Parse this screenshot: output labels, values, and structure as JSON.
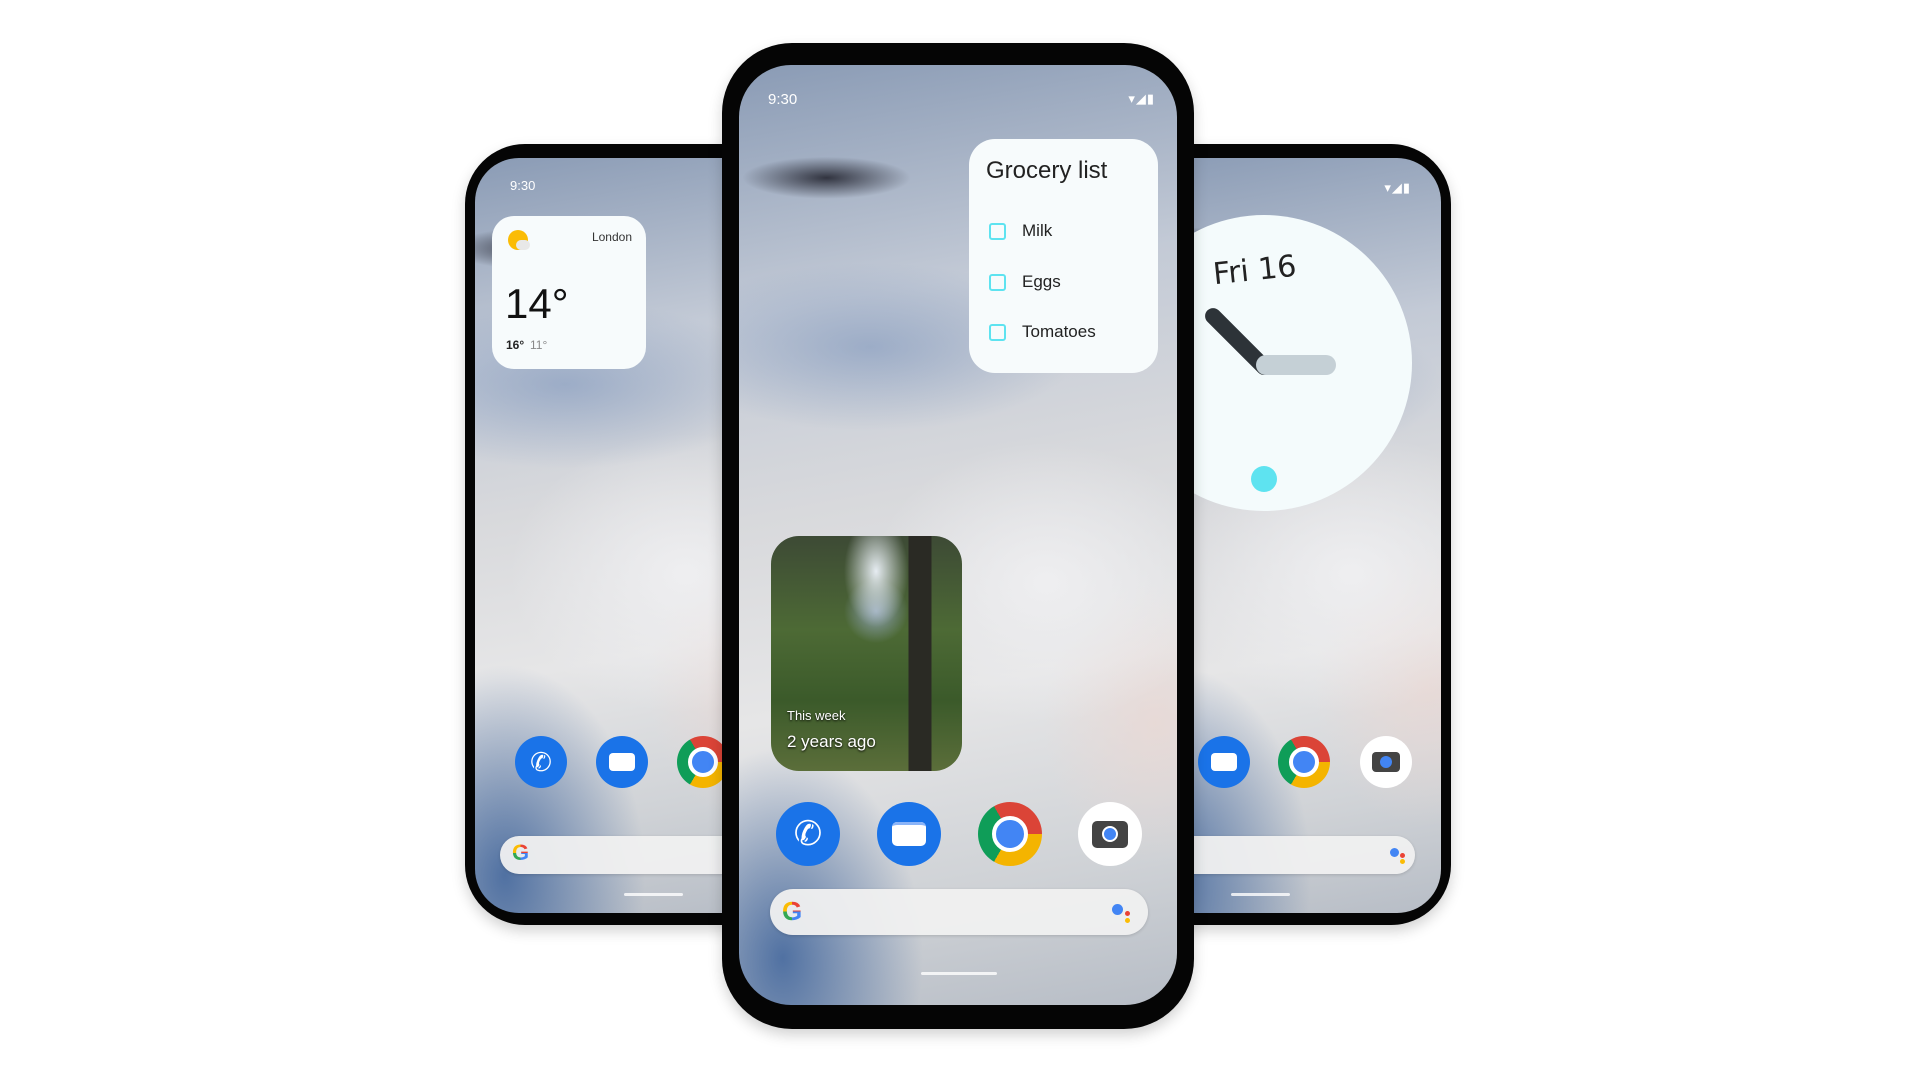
{
  "left_phone": {
    "status_time": "9:30",
    "weather": {
      "city": "London",
      "temp": "14°",
      "high": "16°",
      "low": "11°",
      "icon": "partly-sunny-icon"
    },
    "dock": [
      "phone-icon",
      "messages-icon",
      "chrome-icon"
    ],
    "search_icon": "google-icon"
  },
  "center_phone": {
    "status_time": "9:30",
    "status_icons": [
      "wifi-icon",
      "signal-icon",
      "battery-icon"
    ],
    "grocery": {
      "title": "Grocery list",
      "items": [
        {
          "label": "Milk",
          "checked": false
        },
        {
          "label": "Eggs",
          "checked": false
        },
        {
          "label": "Tomatoes",
          "checked": false
        }
      ],
      "accent": "#5ee3f0"
    },
    "photo": {
      "caption": "This week",
      "subcaption": "2 years ago"
    },
    "dock": [
      "phone-icon",
      "messages-icon",
      "chrome-icon",
      "camera-icon"
    ],
    "search_icons": [
      "google-icon",
      "assistant-icon"
    ]
  },
  "right_phone": {
    "status_icons": [
      "wifi-icon",
      "signal-icon",
      "battery-icon"
    ],
    "clock": {
      "date": "Fri 16",
      "accent": "#5ee3f0"
    },
    "dock": [
      "messages-icon",
      "chrome-icon",
      "camera-icon"
    ],
    "search_icons": [
      "assistant-icon"
    ]
  }
}
